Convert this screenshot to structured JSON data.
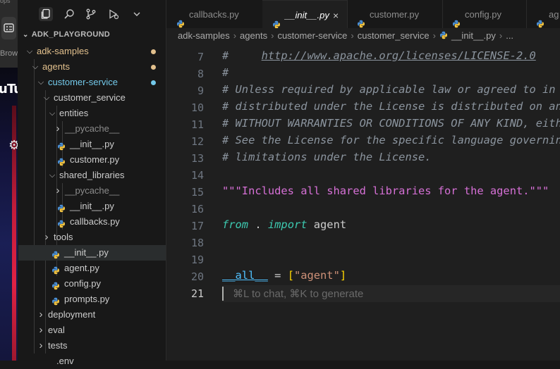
{
  "left_strip": {
    "ops_text": "ops",
    "browser_label": "Brow",
    "video_text": "uTu"
  },
  "activity_bar": {
    "icons": [
      "files-icon",
      "search-icon",
      "source-control-icon",
      "run-debug-icon",
      "chevron-down-icon"
    ]
  },
  "explorer": {
    "title": "ADK_PLAYGROUND",
    "items": [
      {
        "label": "adk-samples",
        "type": "folder-open"
      },
      {
        "label": "agents",
        "type": "folder-open"
      },
      {
        "label": "customer-service",
        "type": "folder-open"
      },
      {
        "label": "customer_service",
        "type": "folder-open"
      },
      {
        "label": "entities",
        "type": "folder-open"
      },
      {
        "label": "__pycache__",
        "type": "folder-closed"
      },
      {
        "label": "__init__.py",
        "type": "py"
      },
      {
        "label": "customer.py",
        "type": "py"
      },
      {
        "label": "shared_libraries",
        "type": "folder-open"
      },
      {
        "label": "__pycache__",
        "type": "folder-closed"
      },
      {
        "label": "__init__.py",
        "type": "py"
      },
      {
        "label": "callbacks.py",
        "type": "py"
      },
      {
        "label": "tools",
        "type": "folder-closed"
      },
      {
        "label": "__init__.py",
        "type": "py"
      },
      {
        "label": "agent.py",
        "type": "py"
      },
      {
        "label": "config.py",
        "type": "py"
      },
      {
        "label": "prompts.py",
        "type": "py"
      },
      {
        "label": "deployment",
        "type": "folder-closed"
      },
      {
        "label": "eval",
        "type": "folder-closed"
      },
      {
        "label": "tests",
        "type": "folder-closed"
      },
      {
        "label": ".env",
        "type": "file"
      }
    ],
    "colors": {
      "modified": "#e2c08d",
      "untracked": "#73c9ea",
      "ignored": "#8b8b8b"
    }
  },
  "tabs": [
    {
      "label": "callbacks.py",
      "active": false
    },
    {
      "label": "__init__.py",
      "active": true,
      "close": "×"
    },
    {
      "label": "customer.py",
      "active": false
    },
    {
      "label": "config.py",
      "active": false
    },
    {
      "label": "ag",
      "active": false
    }
  ],
  "breadcrumb": [
    "adk-samples",
    "agents",
    "customer-service",
    "customer_service",
    "__init__.py",
    "..."
  ],
  "editor": {
    "line_numbers": [
      "7",
      "8",
      "9",
      "10",
      "11",
      "12",
      "13",
      "14",
      "15",
      "16",
      "17",
      "18",
      "19",
      "20",
      "21"
    ],
    "current_line": "21",
    "lines": {
      "l7_hash": "#     ",
      "l7_link": "http://www.apache.org/licenses/LICENSE-2.0",
      "l8": "#",
      "l9": "# Unless required by applicable law or agreed to in writing, software",
      "l10": "# distributed under the License is distributed on an \"AS IS\" BASIS,",
      "l11": "# WITHOUT WARRANTIES OR CONDITIONS OF ANY KIND, either express or implied.",
      "l12": "# See the License for the specific language governing permissions and",
      "l13": "# limitations under the License.",
      "l15": "\"\"\"Includes all shared libraries for the agent.\"\"\"",
      "l17_from": "from",
      "l17_dot": " . ",
      "l17_import": "import",
      "l17_agent": " agent",
      "l20_all": "__all__",
      "l20_eq": " = ",
      "l20_open": "[",
      "l20_str": "\"agent\"",
      "l20_close": "]"
    },
    "inline_hint": "⌘L to chat, ⌘K to generate"
  }
}
